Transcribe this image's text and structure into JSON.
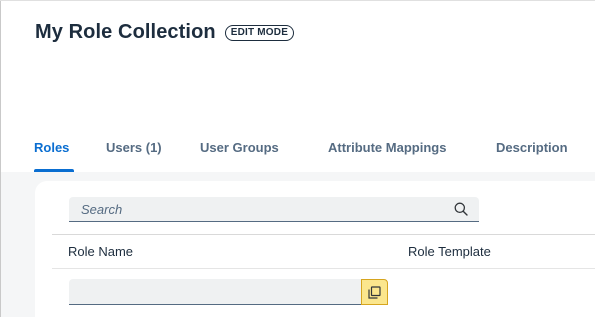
{
  "header": {
    "title": "My Role Collection",
    "mode_badge": "EDIT MODE"
  },
  "tabs": [
    {
      "label": "Roles",
      "selected": true
    },
    {
      "label": "Users (1)",
      "selected": false
    },
    {
      "label": "User Groups",
      "selected": false
    },
    {
      "label": "Attribute Mappings",
      "selected": false
    },
    {
      "label": "Description",
      "selected": false
    }
  ],
  "roles_table": {
    "search": {
      "placeholder": "Search",
      "value": "",
      "icon": "search-icon"
    },
    "columns": [
      "Role Name",
      "Role Template"
    ],
    "new_row": {
      "role_name_value": "",
      "value_help_icon": "value-help-icon"
    }
  },
  "colors": {
    "accent": "#0a6ed1",
    "title_text": "#1d2d3e",
    "tab_text": "#556b82",
    "value_help_highlight": "#fbe68d",
    "content_background": "#f5f6f7"
  }
}
